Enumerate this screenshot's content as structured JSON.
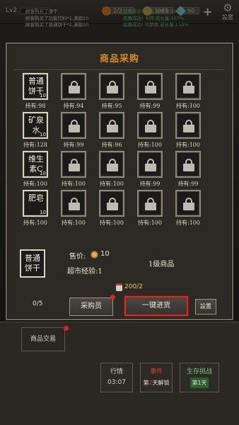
{
  "top": {
    "level": "Lv2",
    "res1": "2/2",
    "res2": "3985",
    "res3": "90",
    "settings_label": "設置"
  },
  "log": {
    "left": [
      "顾客购买了饼干",
      "顾客购买了功能饮料*1,满额20",
      "顾客购买了普通饼干*2,满额20"
    ],
    "right": [
      "招募成功!    高鸣  成长量:96%",
      "招募成功!    卡特  成长量:107%",
      "招募成功!    司梦桥 成长量:110%"
    ]
  },
  "panel": {
    "title": "商品采购",
    "grid": [
      [
        {
          "type": "item",
          "name": "普通饼干",
          "count": "10",
          "held": "持有:98"
        },
        {
          "type": "lock",
          "held": "持有:94"
        },
        {
          "type": "lock",
          "held": "持有:95"
        },
        {
          "type": "lock",
          "held": "持有:99"
        },
        {
          "type": "lock",
          "held": "持有:100"
        }
      ],
      [
        {
          "type": "item",
          "name": "矿泉水",
          "count": "10",
          "held": "持有:128"
        },
        {
          "type": "lock",
          "held": "持有:99"
        },
        {
          "type": "lock",
          "held": "持有:96"
        },
        {
          "type": "lock",
          "held": "持有:100"
        },
        {
          "type": "lock",
          "held": "持有:100"
        }
      ],
      [
        {
          "type": "item",
          "name": "维生素C",
          "count": "10",
          "held": "持有:100"
        },
        {
          "type": "lock",
          "held": "持有:100"
        },
        {
          "type": "lock",
          "held": "持有:100"
        },
        {
          "type": "lock",
          "held": "持有:99"
        },
        {
          "type": "lock",
          "held": "持有:99"
        }
      ],
      [
        {
          "type": "item",
          "name": "肥皂",
          "count": "10",
          "held": "持有:100"
        },
        {
          "type": "lock",
          "held": "持有:100"
        },
        {
          "type": "lock",
          "held": "持有:100"
        },
        {
          "type": "lock",
          "held": "持有:100"
        },
        {
          "type": "lock",
          "held": "持有:100"
        }
      ]
    ],
    "selected": {
      "name": "普通饼干",
      "price_label": "售价:",
      "price_value": "10",
      "exp_label": "超市经验:1",
      "grade": "1级商品",
      "stock": "200/2"
    },
    "count": "0/5",
    "purchase_btn": "采购员",
    "onekey_btn": "一键进货",
    "settings_btn": "設置"
  },
  "bottom": {
    "trade_tab": "商品交易",
    "market": {
      "title": "行情",
      "time": "03:07"
    },
    "event": {
      "title": "事件",
      "pre": "第",
      "num": "2",
      "post": "天解锁"
    },
    "survival": {
      "title": "生存挑战",
      "day": "第1天"
    }
  }
}
